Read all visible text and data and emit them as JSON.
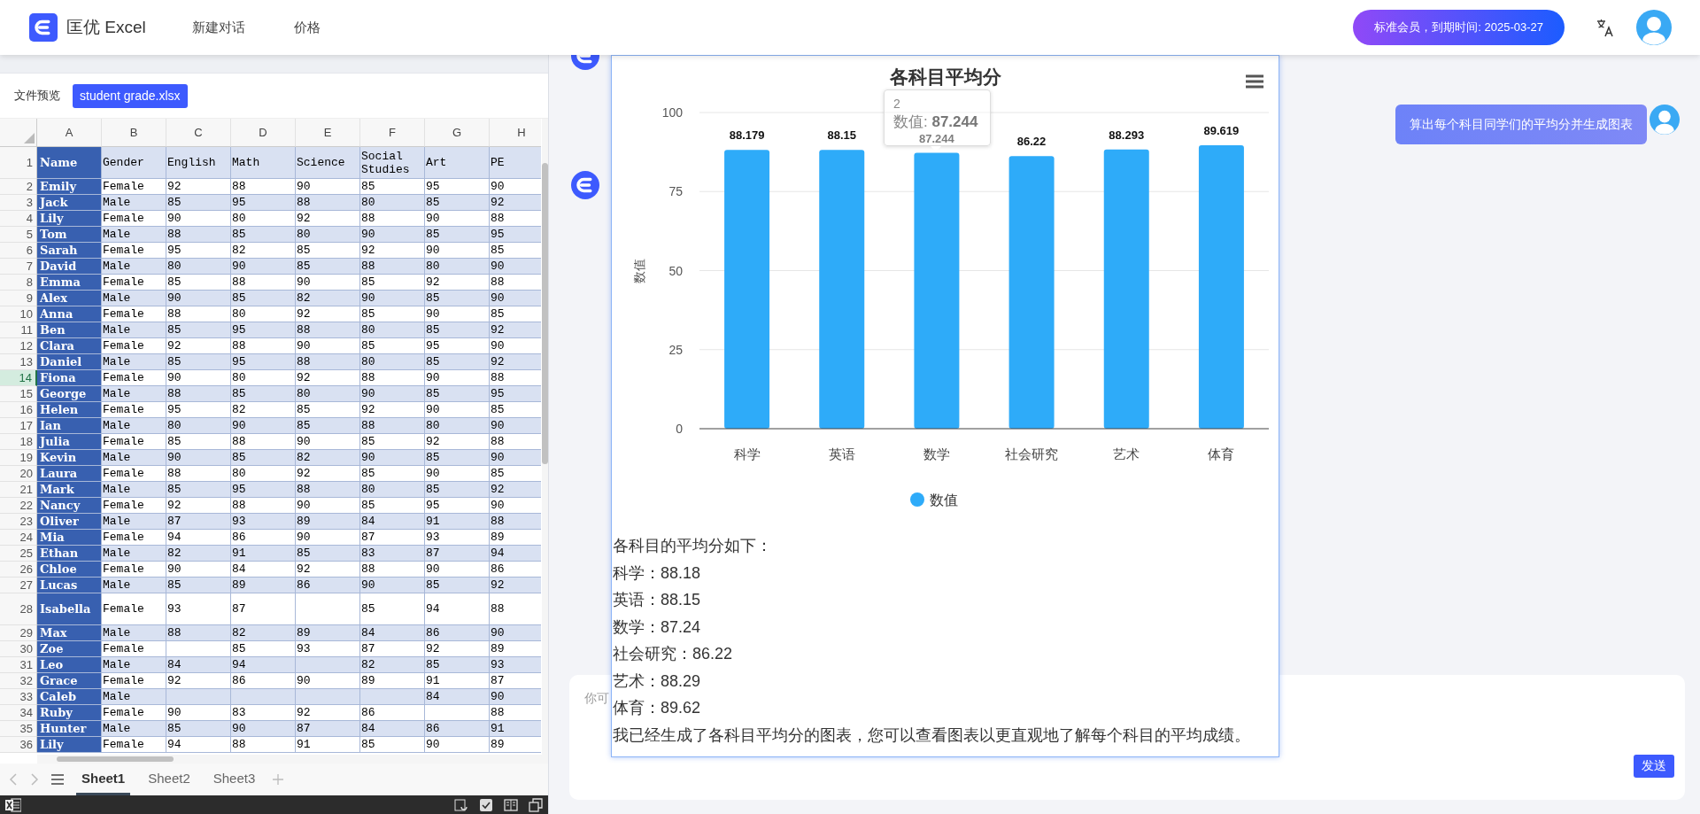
{
  "header": {
    "logo_text": "匡优 Excel",
    "nav": [
      {
        "label": "新建对话"
      },
      {
        "label": "价格"
      }
    ],
    "membership": "标准会员，到期时间: 2025-03-27"
  },
  "file_preview": {
    "label": "文件预览",
    "files": [
      {
        "name": "student grade.xlsx",
        "selected": true
      }
    ]
  },
  "spreadsheet": {
    "columns": [
      "A",
      "B",
      "C",
      "D",
      "E",
      "F",
      "G",
      "H"
    ],
    "rows": [
      {
        "number": "1",
        "selected": false,
        "cells": [
          "Name",
          "Gender",
          "English",
          "Math",
          "Science",
          "Social Studies",
          "Art",
          "PE"
        ]
      },
      {
        "number": "2",
        "selected": false,
        "cells": [
          "Emily",
          "Female",
          "92",
          "88",
          "90",
          "85",
          "95",
          "90"
        ]
      },
      {
        "number": "3",
        "selected": false,
        "cells": [
          "Jack",
          "Male",
          "85",
          "95",
          "88",
          "80",
          "85",
          "92"
        ]
      },
      {
        "number": "4",
        "selected": false,
        "cells": [
          "Lily",
          "Female",
          "90",
          "80",
          "92",
          "88",
          "90",
          "88"
        ]
      },
      {
        "number": "5",
        "selected": false,
        "cells": [
          "Tom",
          "Male",
          "88",
          "85",
          "80",
          "90",
          "85",
          "95"
        ]
      },
      {
        "number": "6",
        "selected": false,
        "cells": [
          "Sarah",
          "Female",
          "95",
          "82",
          "85",
          "92",
          "90",
          "85"
        ]
      },
      {
        "number": "7",
        "selected": false,
        "cells": [
          "David",
          "Male",
          "80",
          "90",
          "85",
          "88",
          "80",
          "90"
        ]
      },
      {
        "number": "8",
        "selected": false,
        "cells": [
          "Emma",
          "Female",
          "85",
          "88",
          "90",
          "85",
          "92",
          "88"
        ]
      },
      {
        "number": "9",
        "selected": false,
        "cells": [
          "Alex",
          "Male",
          "90",
          "85",
          "82",
          "90",
          "85",
          "90"
        ]
      },
      {
        "number": "10",
        "selected": false,
        "cells": [
          "Anna",
          "Female",
          "88",
          "80",
          "92",
          "85",
          "90",
          "85"
        ]
      },
      {
        "number": "11",
        "selected": false,
        "cells": [
          "Ben",
          "Male",
          "85",
          "95",
          "88",
          "80",
          "85",
          "92"
        ]
      },
      {
        "number": "12",
        "selected": false,
        "cells": [
          "Clara",
          "Female",
          "92",
          "88",
          "90",
          "85",
          "95",
          "90"
        ]
      },
      {
        "number": "13",
        "selected": false,
        "cells": [
          "Daniel",
          "Male",
          "85",
          "95",
          "88",
          "80",
          "85",
          "92"
        ]
      },
      {
        "number": "14",
        "selected": true,
        "cells": [
          "Fiona",
          "Female",
          "90",
          "80",
          "92",
          "88",
          "90",
          "88"
        ]
      },
      {
        "number": "15",
        "selected": false,
        "cells": [
          "George",
          "Male",
          "88",
          "85",
          "80",
          "90",
          "85",
          "95"
        ]
      },
      {
        "number": "16",
        "selected": false,
        "cells": [
          "Helen",
          "Female",
          "95",
          "82",
          "85",
          "92",
          "90",
          "85"
        ]
      },
      {
        "number": "17",
        "selected": false,
        "cells": [
          "Ian",
          "Male",
          "80",
          "90",
          "85",
          "88",
          "80",
          "90"
        ]
      },
      {
        "number": "18",
        "selected": false,
        "cells": [
          "Julia",
          "Female",
          "85",
          "88",
          "90",
          "85",
          "92",
          "88"
        ]
      },
      {
        "number": "19",
        "selected": false,
        "cells": [
          "Kevin",
          "Male",
          "90",
          "85",
          "82",
          "90",
          "85",
          "90"
        ]
      },
      {
        "number": "20",
        "selected": false,
        "cells": [
          "Laura",
          "Female",
          "88",
          "80",
          "92",
          "85",
          "90",
          "85"
        ]
      },
      {
        "number": "21",
        "selected": false,
        "cells": [
          "Mark",
          "Male",
          "85",
          "95",
          "88",
          "80",
          "85",
          "92"
        ]
      },
      {
        "number": "22",
        "selected": false,
        "cells": [
          "Nancy",
          "Female",
          "92",
          "88",
          "90",
          "85",
          "95",
          "90"
        ]
      },
      {
        "number": "23",
        "selected": false,
        "cells": [
          "Oliver",
          "Male",
          "87",
          "93",
          "89",
          "84",
          "91",
          "88"
        ]
      },
      {
        "number": "24",
        "selected": false,
        "cells": [
          "Mia",
          "Female",
          "94",
          "86",
          "90",
          "87",
          "93",
          "89"
        ]
      },
      {
        "number": "25",
        "selected": false,
        "cells": [
          "Ethan",
          "Male",
          "82",
          "91",
          "85",
          "83",
          "87",
          "94"
        ]
      },
      {
        "number": "26",
        "selected": false,
        "cells": [
          "Chloe",
          "Female",
          "90",
          "84",
          "92",
          "88",
          "90",
          "86"
        ]
      },
      {
        "number": "27",
        "selected": false,
        "cells": [
          "Lucas",
          "Male",
          "85",
          "89",
          "86",
          "90",
          "85",
          "92"
        ]
      },
      {
        "number": "28",
        "selected": false,
        "cells": [
          "Isabella",
          "Female",
          "93",
          "87",
          null,
          "85",
          "94",
          "88"
        ]
      },
      {
        "number": "29",
        "selected": false,
        "cells": [
          "Max",
          "Male",
          "88",
          "82",
          "89",
          "84",
          "86",
          "90"
        ]
      },
      {
        "number": "30",
        "selected": false,
        "cells": [
          "Zoe",
          "Female",
          null,
          "85",
          "93",
          "87",
          "92",
          "89"
        ]
      },
      {
        "number": "31",
        "selected": false,
        "cells": [
          "Leo",
          "Male",
          "84",
          "94",
          null,
          "82",
          "85",
          "93"
        ]
      },
      {
        "number": "32",
        "selected": false,
        "cells": [
          "Grace",
          "Female",
          "92",
          "86",
          "90",
          "89",
          "91",
          "87"
        ]
      },
      {
        "number": "33",
        "selected": false,
        "cells": [
          "Caleb",
          "Male",
          null,
          null,
          null,
          null,
          "84",
          "90"
        ]
      },
      {
        "number": "34",
        "selected": false,
        "cells": [
          "Ruby",
          "Female",
          "90",
          "83",
          "92",
          "86",
          null,
          "88"
        ]
      },
      {
        "number": "35",
        "selected": false,
        "cells": [
          "Hunter",
          "Male",
          "85",
          "90",
          "87",
          "84",
          "86",
          "91"
        ]
      },
      {
        "number": "36",
        "selected": false,
        "cells": [
          "Lily",
          "Female",
          "94",
          "88",
          "91",
          "85",
          "90",
          "89"
        ]
      }
    ],
    "sheets": [
      {
        "name": "Sheet1",
        "selected": true
      },
      {
        "name": "Sheet2",
        "selected": false
      },
      {
        "name": "Sheet3",
        "selected": false
      }
    ]
  },
  "chat": {
    "messages": [
      {
        "kind": "assistant"
      },
      {
        "kind": "user",
        "text": "算出每个科目同学们的平均分并生成图表"
      },
      {
        "kind": "assistant"
      }
    ],
    "popup": {
      "chart_data": {
        "type": "bar",
        "title": "各科目平均分",
        "ylabel": "数值",
        "categories": [
          "科学",
          "英语",
          "数学",
          "社会研究",
          "艺术",
          "体育"
        ],
        "series": [
          {
            "name": "数值",
            "color": "#2eabf9",
            "values": [
              88.179,
              88.15,
              87.244,
              86.22,
              88.293,
              89.619
            ]
          }
        ],
        "ylim": [
          0,
          100
        ],
        "yticks": [
          0,
          25,
          50,
          75,
          100
        ],
        "grid": true,
        "data_labels": true
      },
      "tooltip": {
        "title": "2",
        "text": "数值: **87.244**"
      },
      "lines": [
        "各科目的平均分如下：",
        "科学：88.18",
        "英语：88.15",
        "数学：87.24",
        "社会研究：86.22",
        "艺术：88.29",
        "体育：89.62",
        "我已经生成了各科目平均分的图表，您可以查看图表以更直观地了解每个科目的平均成绩。"
      ]
    },
    "input": {
      "placeholder": "你可"
    },
    "send_button": "发送"
  }
}
